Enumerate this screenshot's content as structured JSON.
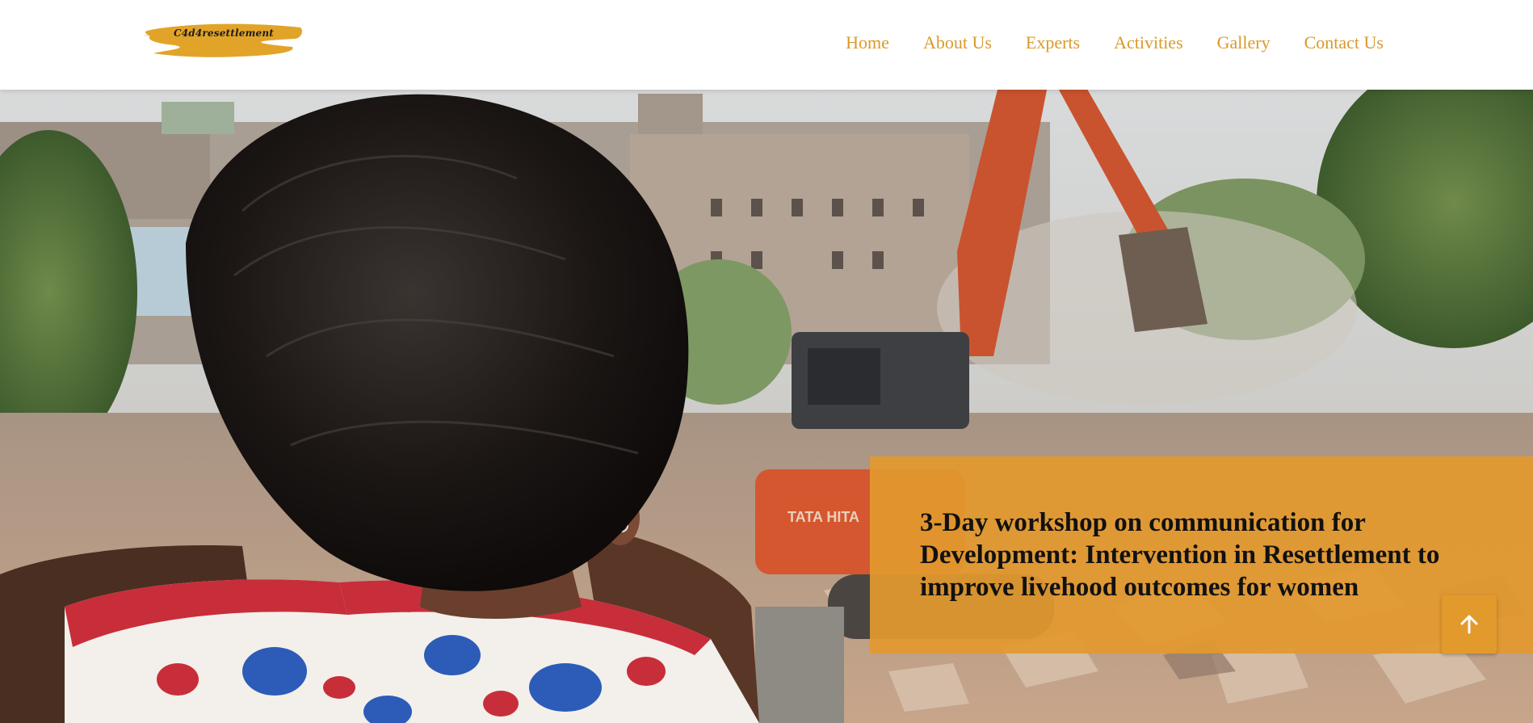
{
  "header": {
    "logo_text": "C4d4resettlement",
    "nav": [
      {
        "label": "Home"
      },
      {
        "label": "About Us"
      },
      {
        "label": "Experts"
      },
      {
        "label": "Activities"
      },
      {
        "label": "Gallery"
      },
      {
        "label": "Contact Us"
      }
    ]
  },
  "hero": {
    "title": "3-Day workshop on communication for Development: Intervention in Resettlement to improve livehood outcomes for women",
    "image_alt": "Child watching an excavator demolish buildings"
  },
  "back_to_top": {
    "icon": "arrow-up-icon"
  },
  "colors": {
    "accent": "#d99a2b",
    "caption_bg": "#e2992e",
    "button_bg": "#e39a2c",
    "header_bg": "#ffffff"
  }
}
